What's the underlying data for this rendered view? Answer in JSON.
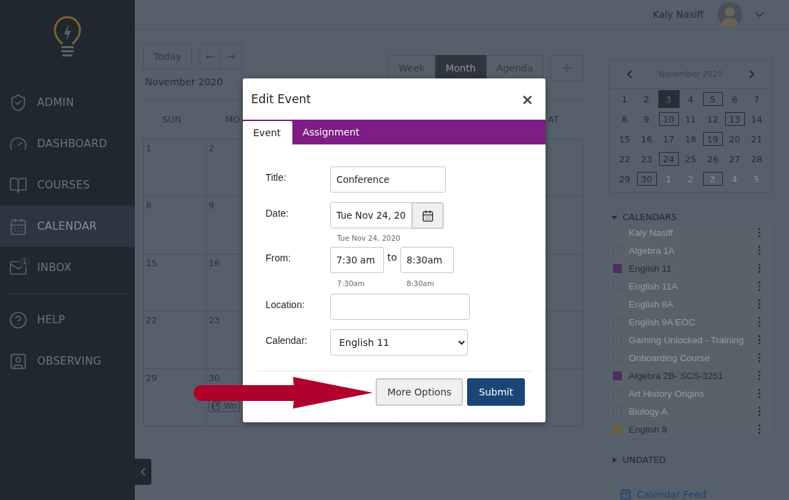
{
  "sidebar": {
    "items": [
      {
        "label": "ADMIN",
        "selected": false
      },
      {
        "label": "DASHBOARD",
        "selected": false
      },
      {
        "label": "COURSES",
        "selected": false
      },
      {
        "label": "CALENDAR",
        "selected": true
      },
      {
        "label": "INBOX",
        "selected": false,
        "badge": "1"
      }
    ],
    "secondary_items": [
      {
        "label": "HELP",
        "selected": false
      },
      {
        "label": "OBSERVING",
        "selected": false
      }
    ]
  },
  "header": {
    "user_name": "Kaly Nasiff"
  },
  "toolbar": {
    "today": "Today",
    "prev": "←",
    "next": "→",
    "month_label": "November 2020",
    "views": [
      {
        "label": "Week",
        "selected": false
      },
      {
        "label": "Month",
        "selected": true
      },
      {
        "label": "Agenda",
        "selected": false
      }
    ]
  },
  "month_grid": {
    "weekday_headers": [
      "SUN",
      "MO"
    ],
    "weekday_headers_right": [
      "AT"
    ],
    "weeks": [
      {
        "sun": "1",
        "mon": "2"
      },
      {
        "sun": "8",
        "mon": "9"
      },
      {
        "sun": "15",
        "mon": "16"
      },
      {
        "sun": "22",
        "mon": "23"
      },
      {
        "sun": "29",
        "mon": "30",
        "event": "Wo"
      }
    ]
  },
  "mini_calendar": {
    "title": "November 2020",
    "weeks": [
      [
        {
          "day": "1",
          "selected": false,
          "marked": false,
          "outside": false
        },
        {
          "day": "2",
          "selected": false,
          "marked": false,
          "outside": false
        },
        {
          "day": "3",
          "selected": true,
          "marked": false,
          "outside": false
        },
        {
          "day": "4",
          "selected": false,
          "marked": false,
          "outside": false
        },
        {
          "day": "5",
          "selected": false,
          "marked": true,
          "outside": false
        },
        {
          "day": "6",
          "selected": false,
          "marked": false,
          "outside": false
        },
        {
          "day": "7",
          "selected": false,
          "marked": false,
          "outside": false
        }
      ],
      [
        {
          "day": "8",
          "selected": false,
          "marked": false,
          "outside": false
        },
        {
          "day": "9",
          "selected": false,
          "marked": false,
          "outside": false
        },
        {
          "day": "10",
          "selected": false,
          "marked": true,
          "outside": false
        },
        {
          "day": "11",
          "selected": false,
          "marked": false,
          "outside": false
        },
        {
          "day": "12",
          "selected": false,
          "marked": false,
          "outside": false
        },
        {
          "day": "13",
          "selected": false,
          "marked": true,
          "outside": false
        },
        {
          "day": "14",
          "selected": false,
          "marked": false,
          "outside": false
        }
      ],
      [
        {
          "day": "15",
          "selected": false,
          "marked": false,
          "outside": false
        },
        {
          "day": "16",
          "selected": false,
          "marked": false,
          "outside": false
        },
        {
          "day": "17",
          "selected": false,
          "marked": false,
          "outside": false
        },
        {
          "day": "18",
          "selected": false,
          "marked": false,
          "outside": false
        },
        {
          "day": "19",
          "selected": false,
          "marked": true,
          "outside": false
        },
        {
          "day": "20",
          "selected": false,
          "marked": false,
          "outside": false
        },
        {
          "day": "21",
          "selected": false,
          "marked": false,
          "outside": false
        }
      ],
      [
        {
          "day": "22",
          "selected": false,
          "marked": false,
          "outside": false
        },
        {
          "day": "23",
          "selected": false,
          "marked": false,
          "outside": false
        },
        {
          "day": "24",
          "selected": false,
          "marked": true,
          "outside": false
        },
        {
          "day": "25",
          "selected": false,
          "marked": false,
          "outside": false
        },
        {
          "day": "26",
          "selected": false,
          "marked": false,
          "outside": false
        },
        {
          "day": "27",
          "selected": false,
          "marked": false,
          "outside": false
        },
        {
          "day": "28",
          "selected": false,
          "marked": false,
          "outside": false
        }
      ],
      [
        {
          "day": "29",
          "selected": false,
          "marked": false,
          "outside": false
        },
        {
          "day": "30",
          "selected": false,
          "marked": true,
          "outside": false
        },
        {
          "day": "1",
          "selected": false,
          "marked": false,
          "outside": true
        },
        {
          "day": "2",
          "selected": false,
          "marked": false,
          "outside": true
        },
        {
          "day": "3",
          "selected": false,
          "marked": true,
          "outside": true
        },
        {
          "day": "4",
          "selected": false,
          "marked": false,
          "outside": true
        },
        {
          "day": "5",
          "selected": false,
          "marked": false,
          "outside": true
        }
      ]
    ]
  },
  "calendars": {
    "heading": "CALENDARS",
    "expanded": true,
    "items": [
      {
        "name": "Kaly Nasiff",
        "checked": false
      },
      {
        "name": "Algebra 1A",
        "checked": false
      },
      {
        "name": "English 11",
        "checked": true,
        "color": "#4b2f5c"
      },
      {
        "name": "English 11A",
        "checked": false
      },
      {
        "name": "English 8A",
        "checked": false
      },
      {
        "name": "English 9A EOC",
        "checked": false
      },
      {
        "name": "Gaming Unlocked - Training",
        "checked": false
      },
      {
        "name": "Onboarding Course",
        "checked": false
      },
      {
        "name": "Algebra 2B- SCS-3251",
        "checked": true,
        "color": "#4b2f5c"
      },
      {
        "name": "Art History Origins",
        "checked": false
      },
      {
        "name": "Biology A",
        "checked": false
      },
      {
        "name": "English 9",
        "checked": true,
        "color": "#6b6036"
      }
    ]
  },
  "undated": {
    "heading": "UNDATED",
    "expanded": false
  },
  "calendar_feed": "Calendar Feed",
  "modal": {
    "title": "Edit Event",
    "close": "×",
    "tabs": [
      {
        "label": "Event",
        "selected": true
      },
      {
        "label": "Assignment",
        "selected": false
      }
    ],
    "title_field": {
      "label": "Title:",
      "value": "Conference"
    },
    "date_field": {
      "label": "Date:",
      "value": "Tue Nov 24, 20",
      "hint": "Tue Nov 24, 2020"
    },
    "time_field": {
      "label": "From:",
      "from": "7:30 am",
      "to_word": "to",
      "to": "8:30am",
      "from_hint": "7:30am",
      "to_hint": "8:30am"
    },
    "location_field": {
      "label": "Location:"
    },
    "calendar_field": {
      "label": "Calendar:",
      "value": "English 11"
    },
    "buttons": {
      "more_options": "More Options",
      "submit": "Submit"
    }
  }
}
